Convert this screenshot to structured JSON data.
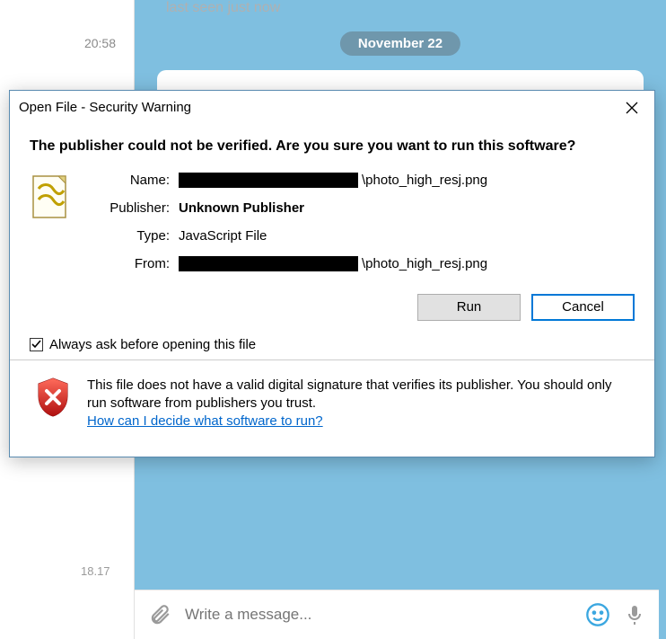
{
  "chat": {
    "top_faded_text": "last seen just now",
    "left_time": "20:58",
    "date_pill": "November 22",
    "bottom_time": "18.17",
    "input_placeholder": "Write a message..."
  },
  "dialog": {
    "title": "Open File - Security Warning",
    "heading": "The publisher could not be verified.  Are you sure you want to run this software?",
    "fields": {
      "name_label": "Name:",
      "name_value_tail": "\\photo_high_resj.png",
      "publisher_label": "Publisher:",
      "publisher_value": "Unknown Publisher",
      "type_label": "Type:",
      "type_value": "JavaScript File",
      "from_label": "From:",
      "from_value_tail": "\\photo_high_resj.png"
    },
    "buttons": {
      "run": "Run",
      "cancel": "Cancel"
    },
    "checkbox_label": "Always ask before opening this file",
    "checkbox_checked": true,
    "footer_text": "This file does not have a valid digital signature that verifies its publisher.  You should only run software from publishers you trust.",
    "footer_link": "How can I decide what software to run?"
  }
}
